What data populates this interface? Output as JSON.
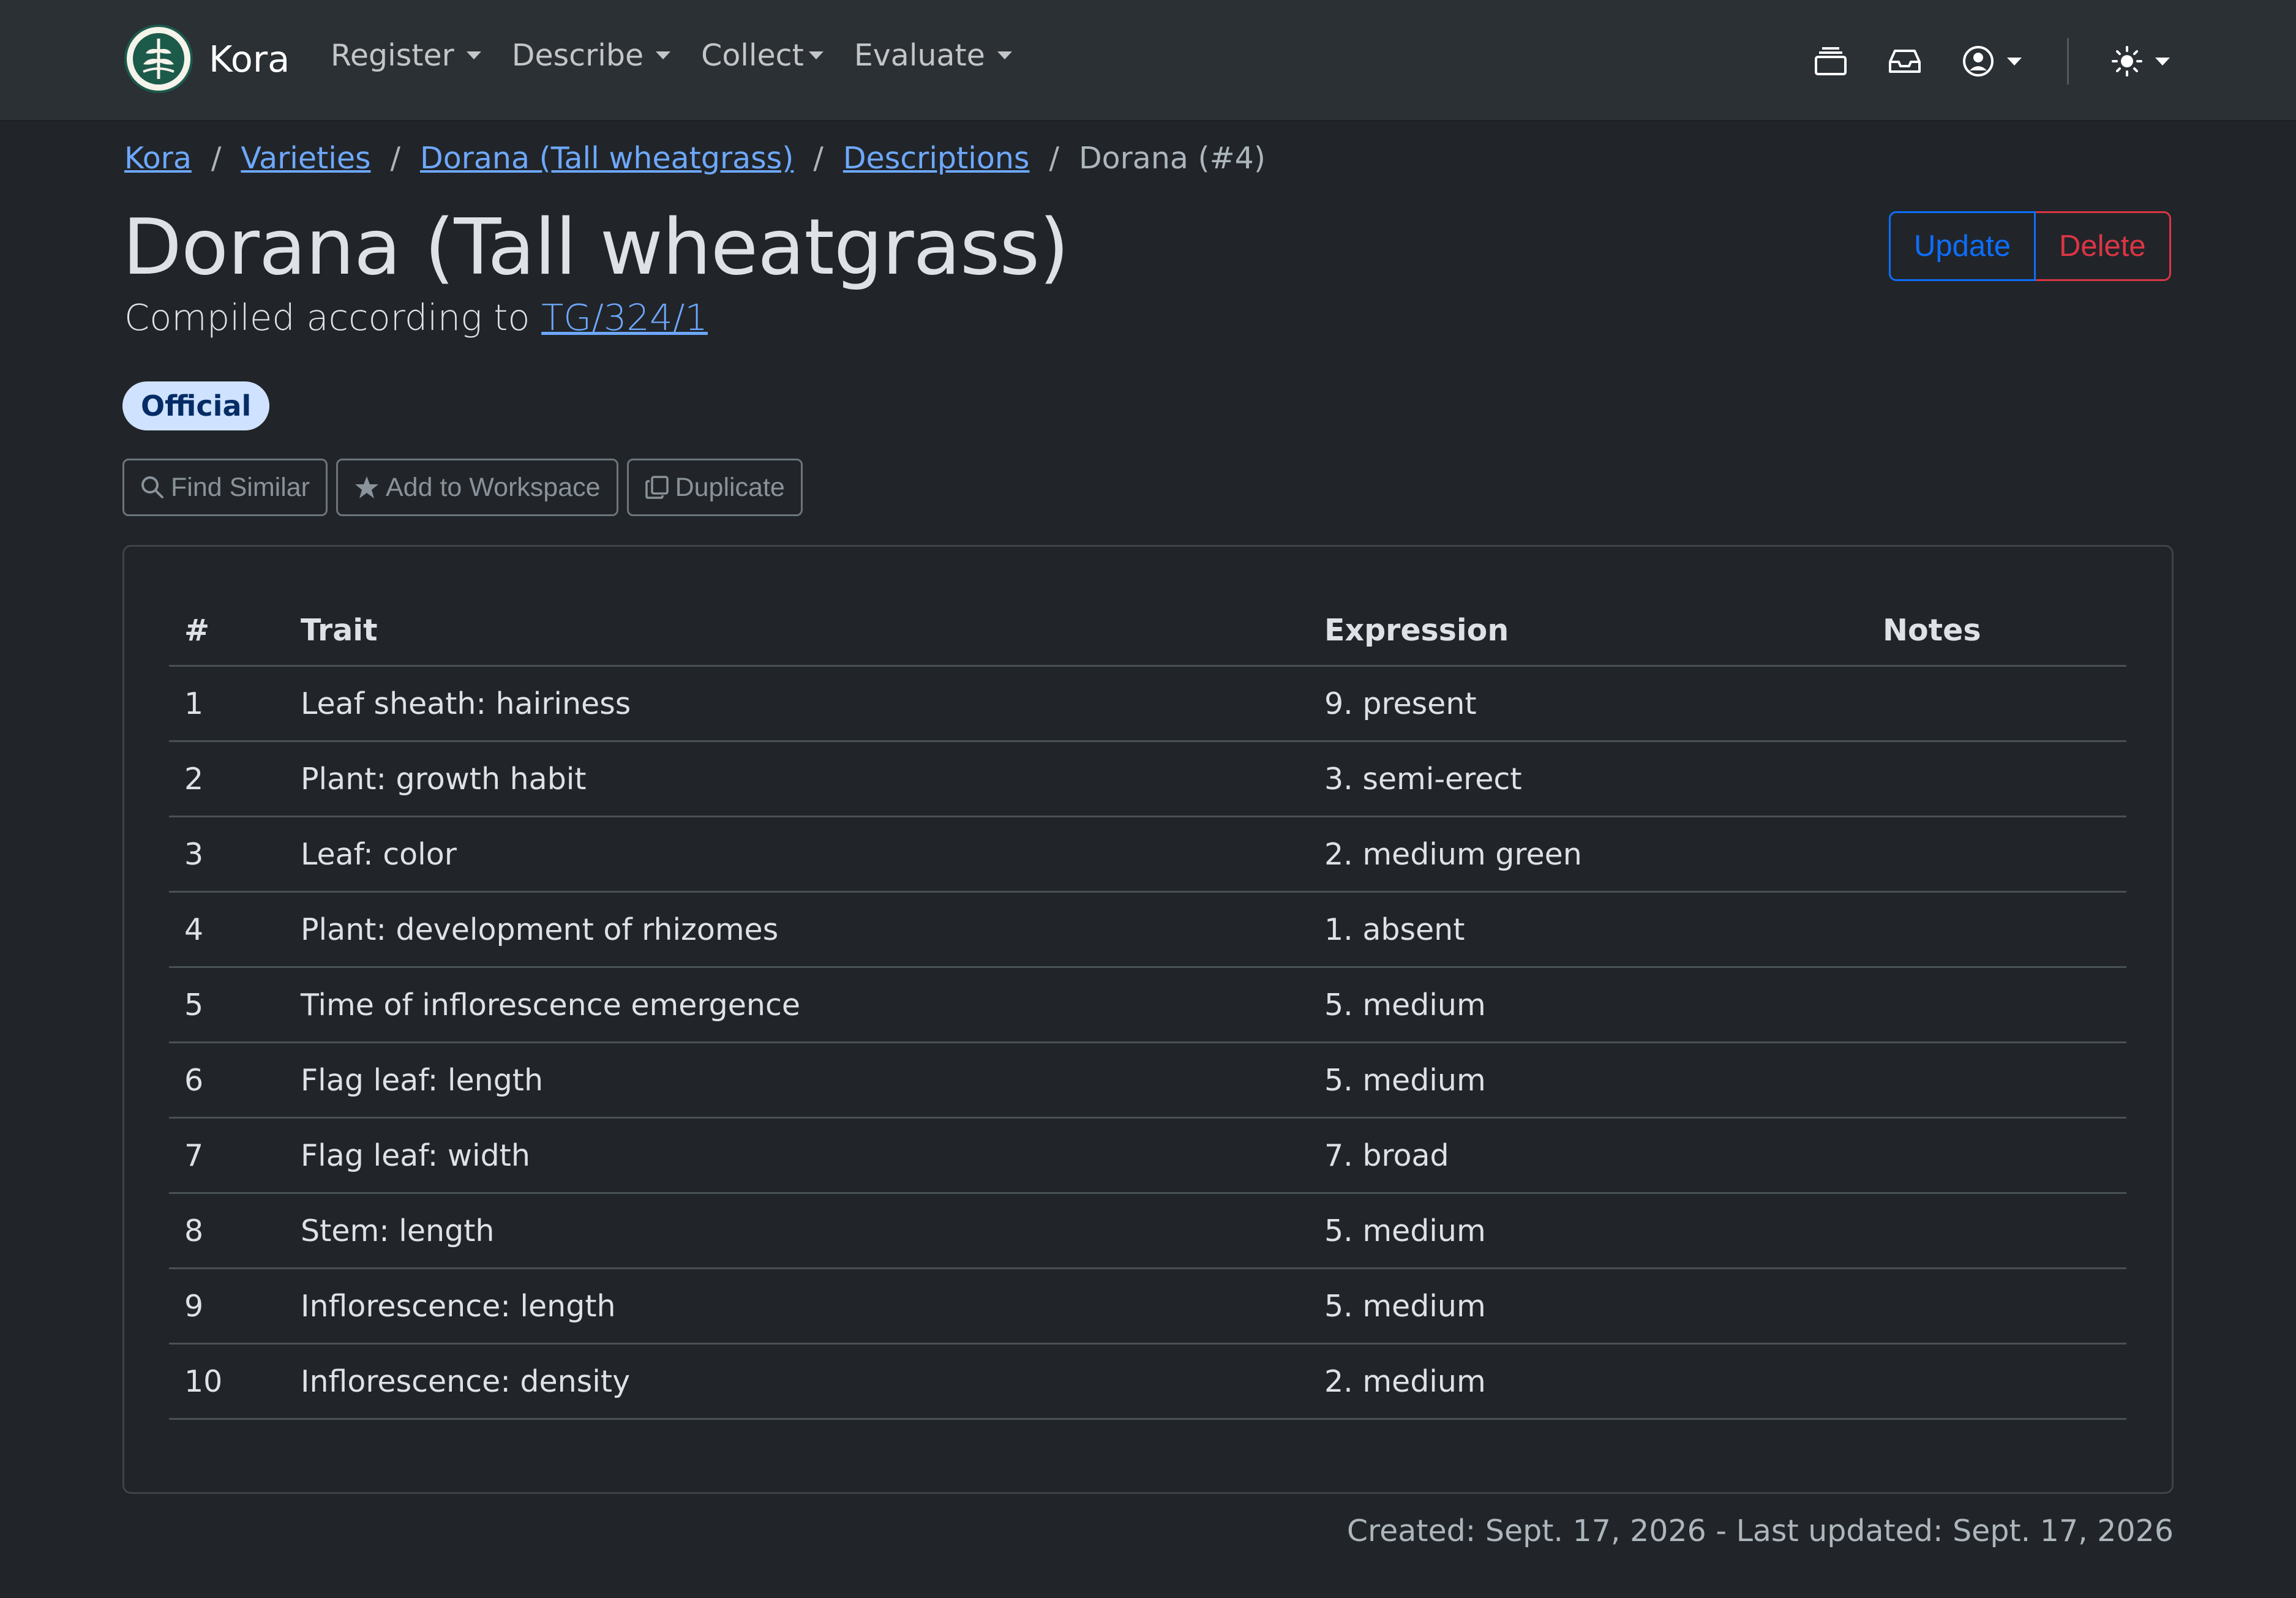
{
  "navbar": {
    "brand_name": "Kora",
    "menu": [
      {
        "label": "Register"
      },
      {
        "label": "Describe"
      },
      {
        "label": "Collect"
      },
      {
        "label": "Evaluate"
      }
    ],
    "icons": [
      "stack-icon",
      "inbox-icon",
      "user-circle-icon",
      "sun-icon"
    ]
  },
  "breadcrumb": {
    "items": [
      "Kora",
      "Varieties",
      "Dorana (Tall wheatgrass)",
      "Descriptions"
    ],
    "separator": "/",
    "active": "Dorana (#4)"
  },
  "header": {
    "title": "Dorana (Tall wheatgrass)",
    "subtitle_prefix": "Compiled according to",
    "subtitle_link": "TG/324/1",
    "update_label": "Update",
    "delete_label": "Delete",
    "badge": "Official"
  },
  "actions": {
    "find_similar": "Find Similar",
    "add_to_workspace": "Add to Workspace",
    "duplicate": "Duplicate"
  },
  "table": {
    "headers": {
      "num": "#",
      "trait": "Trait",
      "expression": "Expression",
      "notes": "Notes"
    },
    "rows": [
      {
        "num": "1",
        "trait": "Leaf sheath: hairiness",
        "expression": "9. present",
        "notes": ""
      },
      {
        "num": "2",
        "trait": "Plant: growth habit",
        "expression": "3. semi-erect",
        "notes": ""
      },
      {
        "num": "3",
        "trait": "Leaf: color",
        "expression": "2. medium green",
        "notes": ""
      },
      {
        "num": "4",
        "trait": "Plant: development of rhizomes",
        "expression": "1. absent",
        "notes": ""
      },
      {
        "num": "5",
        "trait": "Time of inflorescence emergence",
        "expression": "5. medium",
        "notes": ""
      },
      {
        "num": "6",
        "trait": "Flag leaf: length",
        "expression": "5. medium",
        "notes": ""
      },
      {
        "num": "7",
        "trait": "Flag leaf: width",
        "expression": "7. broad",
        "notes": ""
      },
      {
        "num": "8",
        "trait": "Stem: length",
        "expression": "5. medium",
        "notes": ""
      },
      {
        "num": "9",
        "trait": "Inflorescence: length",
        "expression": "5. medium",
        "notes": ""
      },
      {
        "num": "10",
        "trait": "Inflorescence: density",
        "expression": "2. medium",
        "notes": ""
      }
    ]
  },
  "footer": {
    "meta": "Created: Sept. 17, 2026 - Last updated: Sept. 17, 2026"
  },
  "colors": {
    "background": "#212529",
    "navbar": "#2b3035",
    "link": "#6ea8fe",
    "primary": "#0d6efd",
    "danger": "#dc3545",
    "badge_bg": "#cfe2ff",
    "badge_text": "#052c65"
  }
}
